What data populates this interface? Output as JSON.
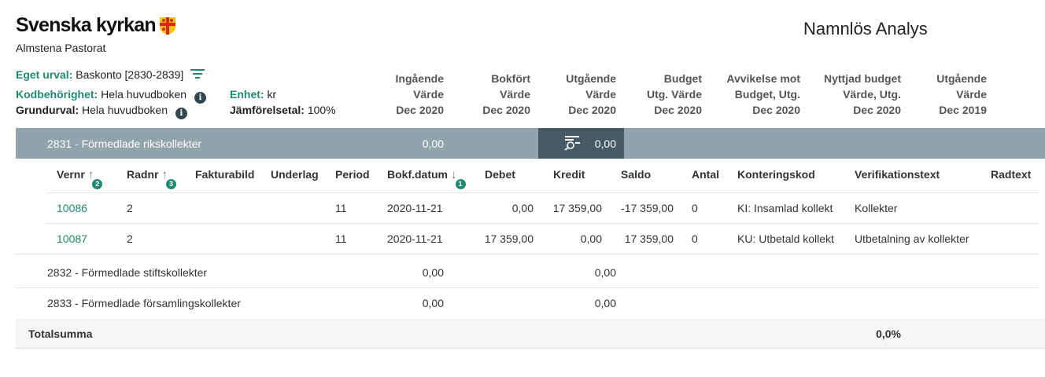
{
  "header": {
    "brand": "Svenska kyrkan",
    "org": "Almstena Pastorat",
    "report_title": "Namnlös Analys"
  },
  "filters": {
    "eget_urval_label": "Eget urval:",
    "eget_urval_value": "Baskonto [2830-2839]",
    "kodbehorighet_label": "Kodbehörighet:",
    "kodbehorighet_value": "Hela huvudboken",
    "grundurval_label": "Grundurval:",
    "grundurval_value": "Hela huvudboken",
    "enhet_label": "Enhet:",
    "enhet_value": "kr",
    "jamforelsetal_label": "Jämförelsetal:",
    "jamforelsetal_value": "100%"
  },
  "columns": [
    {
      "l1": "Ingående",
      "l2": "Värde",
      "l3": "Dec 2020"
    },
    {
      "l1": "Bokfört",
      "l2": "Värde",
      "l3": "Dec 2020"
    },
    {
      "l1": "Utgående",
      "l2": "Värde",
      "l3": "Dec 2020"
    },
    {
      "l1": "Budget",
      "l2": "Utg. Värde",
      "l3": "Dec 2020"
    },
    {
      "l1": "Avvikelse mot",
      "l2": "Budget, Utg.",
      "l3": "Dec 2020"
    },
    {
      "l1": "Nyttjad budget",
      "l2": "Värde, Utg.",
      "l3": "Dec 2020"
    },
    {
      "l1": "Utgående",
      "l2": "Värde",
      "l3": "Dec 2019"
    }
  ],
  "group_2831": {
    "label": "2831 - Förmedlade rikskollekter",
    "ingaende": "0,00",
    "bokfort": "0,00"
  },
  "detail": {
    "headers": {
      "vernr": "Vernr",
      "vernr_badge": "2",
      "radnr": "Radnr",
      "radnr_badge": "3",
      "fakturabild": "Fakturabild",
      "underlag": "Underlag",
      "period": "Period",
      "bokfdatum": "Bokf.datum",
      "bokfdatum_badge": "1",
      "debet": "Debet",
      "kredit": "Kredit",
      "saldo": "Saldo",
      "antal": "Antal",
      "konteringskod": "Konteringskod",
      "verifikationstext": "Verifikationstext",
      "radtext": "Radtext"
    },
    "rows": [
      {
        "vernr": "10086",
        "radnr": "2",
        "period": "11",
        "datum": "2020-11-21",
        "debet": "0,00",
        "kredit": "17 359,00",
        "saldo": "-17 359,00",
        "antal": "0",
        "kod": "KI: Insamlad kollekt",
        "vertext": "Kollekter"
      },
      {
        "vernr": "10087",
        "radnr": "2",
        "period": "11",
        "datum": "2020-11-21",
        "debet": "17 359,00",
        "kredit": "0,00",
        "saldo": "17 359,00",
        "antal": "0",
        "kod": "KU: Utbetald kollekt",
        "vertext": "Utbetalning av kollekter"
      }
    ]
  },
  "group_2832": {
    "label": "2832 - Förmedlade stiftskollekter",
    "ingaende": "0,00",
    "utgaende": "0,00"
  },
  "group_2833": {
    "label": "2833 - Förmedlade församlingskollekter",
    "ingaende": "0,00",
    "utgaende": "0,00"
  },
  "total": {
    "label": "Totalsumma",
    "nyttjad": "0,0%"
  },
  "icons": [
    "filter-icon",
    "info-icon",
    "drilldown-filter-icon",
    "sort-up-icon",
    "sort-down-icon"
  ],
  "colors": {
    "accent": "#1f8a70",
    "group_bar": "#90a4ab",
    "group_bar_dark": "#455a64"
  }
}
